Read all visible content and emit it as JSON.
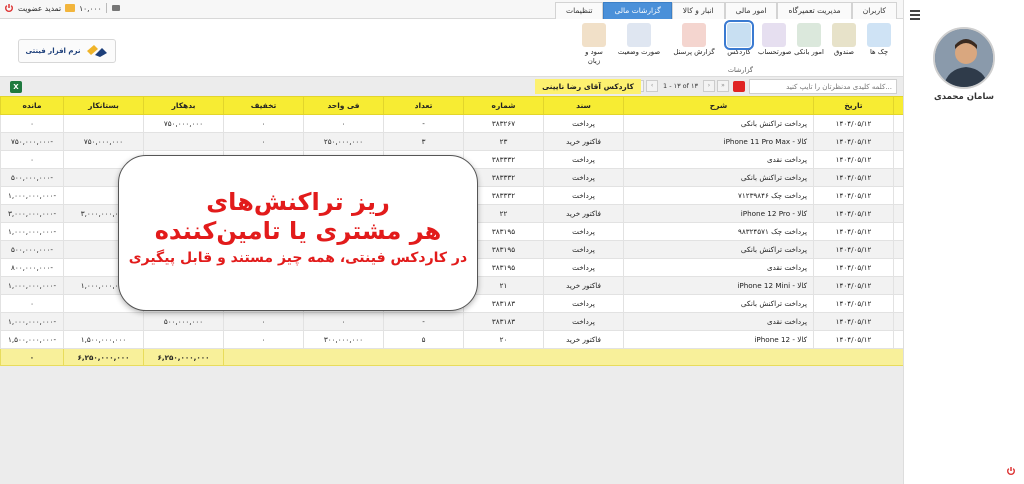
{
  "header": {
    "tabs": [
      "کاربران",
      "مدیریت تعمیرگاه",
      "امور مالی",
      "انبار و کالا",
      "گزارشات مالی",
      "تنظیمات"
    ],
    "active_tab_index": 4,
    "renew_label": "تمدید عضویت",
    "balance": "۱۰,۰۰۰"
  },
  "sidebar": {
    "user_name": "سامان محمدی"
  },
  "ribbon": {
    "logo_text": "نرم افزار فینتی",
    "tools": [
      {
        "label": "چک ها",
        "icon": "checks-icon"
      },
      {
        "label": "صندوق",
        "icon": "cashbox-icon"
      },
      {
        "label": "امور بانکی",
        "icon": "bank-icon"
      },
      {
        "label": "صورتحساب",
        "icon": "invoice-icon"
      },
      {
        "label": "کاردکس",
        "icon": "kardex-icon"
      },
      {
        "label": "گزارش پرسنل",
        "icon": "staff-report-icon"
      },
      {
        "label": "صورت وضعیت",
        "icon": "statement-icon"
      },
      {
        "label": "سود و زیان",
        "icon": "profit-loss-icon"
      }
    ],
    "active_tool_index": 4,
    "group_label": "گزارشات"
  },
  "toolbar": {
    "search_placeholder": "کلمه کلیدی مدنظرتان را تایپ کنید...",
    "pager_info": "1 - ۱۳ of ۱۳",
    "kardex_title": "کاردکس آقای رضا نایینی",
    "excel_label": "X"
  },
  "table": {
    "columns": [
      "#",
      "تاریخ",
      "شرح",
      "سند",
      "شماره",
      "تعداد",
      "فی واحد",
      "تخفیف",
      "بدهکار",
      "بستانکار",
      "مانده"
    ],
    "rows": [
      [
        "۱",
        "۱۴۰۴/۰۵/۱۲",
        "پرداخت تراکنش بانکی",
        "پرداخت",
        "۳۸۳۲۶۷",
        "-",
        "۰",
        "۰",
        "۷۵۰,۰۰۰,۰۰۰",
        "",
        "۰"
      ],
      [
        "۲",
        "۱۴۰۴/۰۵/۱۲",
        "کالا - iPhone 11 Pro Max",
        "فاکتور خرید",
        "۲۳",
        "۳",
        "۲۵۰,۰۰۰,۰۰۰",
        "۰",
        "",
        "۷۵۰,۰۰۰,۰۰۰",
        "-۷۵۰,۰۰۰,۰۰۰"
      ],
      [
        "۳",
        "۱۴۰۴/۰۵/۱۲",
        "پرداخت نقدی",
        "پرداخت",
        "۳۸۳۳۳۲",
        "",
        "",
        "",
        "",
        "",
        "۰"
      ],
      [
        "۴",
        "۱۴۰۴/۰۵/۱۲",
        "پرداخت تراکنش بانکی",
        "پرداخت",
        "۳۸۳۳۳۲",
        "",
        "",
        "",
        "",
        "",
        "-۵۰۰,۰۰۰,۰۰۰"
      ],
      [
        "۵",
        "۱۴۰۴/۰۵/۱۲",
        "پرداخت چک ۷۱۲۳۹۸۴۶",
        "پرداخت",
        "۳۸۳۳۳۲",
        "",
        "",
        "",
        "",
        "",
        "-۱,۰۰۰,۰۰۰,۰۰۰"
      ],
      [
        "۶",
        "۱۴۰۴/۰۵/۱۲",
        "کالا - iPhone 12 Pro",
        "فاکتور خرید",
        "۲۲",
        "",
        "",
        "",
        "",
        "۳,۰۰۰,۰۰۰,۰۰۰",
        "-۳,۰۰۰,۰۰۰,۰۰۰"
      ],
      [
        "۷",
        "۱۴۰۴/۰۵/۱۲",
        "پرداخت چک ۹۸۳۲۴۵۷۱",
        "پرداخت",
        "۳۸۳۱۹۵",
        "",
        "",
        "",
        "",
        "",
        "-۱,۰۰۰,۰۰۰,۰۰۰"
      ],
      [
        "۸",
        "۱۴۰۴/۰۵/۱۲",
        "پرداخت تراکنش بانکی",
        "پرداخت",
        "۳۸۳۱۹۵",
        "",
        "",
        "",
        "",
        "",
        "-۵۰۰,۰۰۰,۰۰۰"
      ],
      [
        "۹",
        "۱۴۰۴/۰۵/۱۲",
        "پرداخت نقدی",
        "پرداخت",
        "۳۸۳۱۹۵",
        "",
        "",
        "",
        "",
        "",
        "-۸۰۰,۰۰۰,۰۰۰"
      ],
      [
        "۱۰",
        "۱۴۰۴/۰۵/۱۲",
        "کالا - iPhone 12 Mini",
        "فاکتور خرید",
        "۲۱",
        "",
        "",
        "",
        "",
        "۱,۰۰۰,۰۰۰,۰۰۰",
        "-۱,۰۰۰,۰۰۰,۰۰۰"
      ],
      [
        "۱۱",
        "۱۴۰۴/۰۵/۱۲",
        "پرداخت تراکنش بانکی",
        "پرداخت",
        "۳۸۳۱۸۳",
        "-",
        "۰",
        "۰",
        "۱,۰۰۰,۰۰۰,۰۰۰",
        "",
        "۰"
      ],
      [
        "۱۲",
        "۱۴۰۴/۰۵/۱۲",
        "پرداخت نقدی",
        "پرداخت",
        "۳۸۳۱۸۳",
        "-",
        "۰",
        "۰",
        "۵۰۰,۰۰۰,۰۰۰",
        "",
        "-۱,۰۰۰,۰۰۰,۰۰۰"
      ],
      [
        "۱۳",
        "۱۴۰۴/۰۵/۱۲",
        "کالا - iPhone 12",
        "فاکتور خرید",
        "۲۰",
        "۵",
        "۳۰۰,۰۰۰,۰۰۰",
        "۰",
        "",
        "۱,۵۰۰,۰۰۰,۰۰۰",
        "-۱,۵۰۰,۰۰۰,۰۰۰"
      ]
    ],
    "totals": {
      "debit": "۶,۲۵۰,۰۰۰,۰۰۰",
      "credit": "۶,۲۵۰,۰۰۰,۰۰۰",
      "balance": "۰"
    }
  },
  "overlay": {
    "line1": "ریز تراکنش‌های",
    "line2": "هر مشتری یا تامین‌کننده",
    "line3": "در کاردکس فینتی، همه چیز مستند و قابل پیگیری"
  },
  "colors": {
    "accent": "#4a90d9",
    "header_yellow": "#f7ec33",
    "overlay_red": "#e21b1b"
  }
}
